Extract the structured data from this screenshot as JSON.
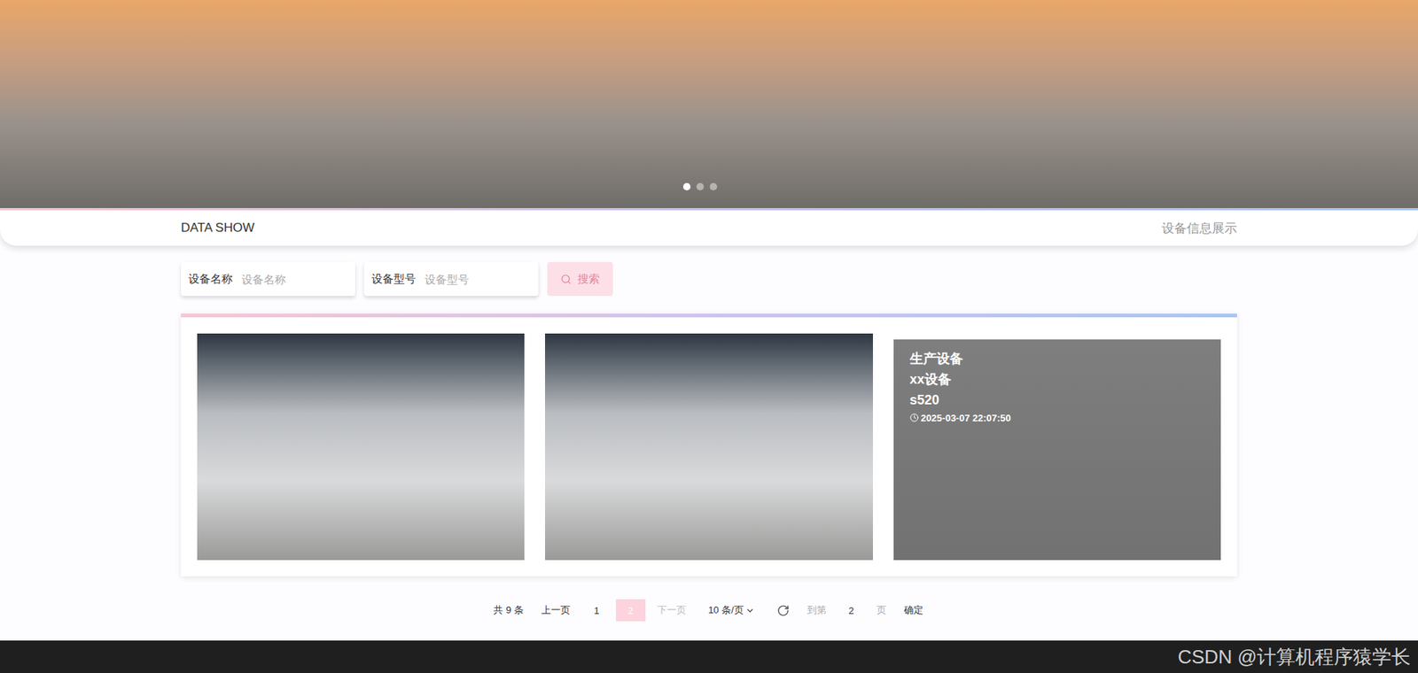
{
  "banner": {
    "dots": [
      {
        "selected": true
      },
      {
        "selected": false
      },
      {
        "selected": false
      }
    ]
  },
  "header": {
    "title": "DATA SHOW",
    "subtitle": "设备信息展示"
  },
  "search": {
    "fields": [
      {
        "label": "设备名称",
        "placeholder": "设备名称"
      },
      {
        "label": "设备型号",
        "placeholder": "设备型号"
      }
    ],
    "button": "搜索"
  },
  "cards": [
    {
      "hovered": false
    },
    {
      "hovered": false
    },
    {
      "hovered": true,
      "category": "生产设备",
      "name": "xx设备",
      "model": "s520",
      "time": "2025-03-07 22:07:50"
    }
  ],
  "pagination": {
    "total": "共 9 条",
    "prev": "上一页",
    "pages": [
      {
        "label": "1",
        "selected": false
      },
      {
        "label": "2",
        "selected": true
      }
    ],
    "next": "下一页",
    "next_disabled": true,
    "page_size": "10 条/页",
    "goto_label": "到第",
    "goto_value": "2",
    "goto_suffix": "页",
    "confirm": "确定"
  },
  "watermark": "CSDN @计算机程序猿学长"
}
